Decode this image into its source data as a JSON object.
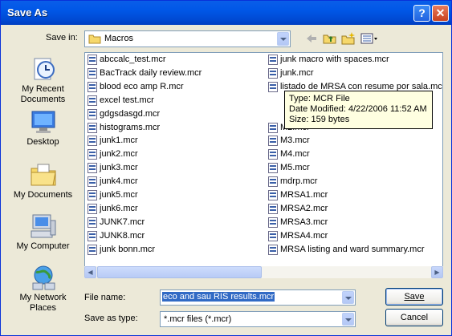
{
  "window": {
    "title": "Save As"
  },
  "header": {
    "save_in_label": "Save in:",
    "save_in_value": "Macros"
  },
  "sidebar": [
    {
      "label": "My Recent Documents"
    },
    {
      "label": "Desktop"
    },
    {
      "label": "My Documents"
    },
    {
      "label": "My Computer"
    },
    {
      "label": "My Network Places"
    }
  ],
  "files_col1": [
    "abccalc_test.mcr",
    "BacTrack daily review.mcr",
    "blood eco amp R.mcr",
    "excel test.mcr",
    "gdgsdasgd.mcr",
    "histograms.mcr",
    "junk1.mcr",
    "junk2.mcr",
    "junk3.mcr",
    "junk4.mcr",
    "junk5.mcr",
    "junk6.mcr",
    "JUNK7.mcr",
    "JUNK8.mcr",
    "junk bonn.mcr"
  ],
  "files_col2": [
    "junk macro with spaces.mcr",
    "junk.mcr",
    "listado de MRSA con resume por sala.mcr",
    "",
    "",
    "M2.mcr",
    "M3.mcr",
    "M4.mcr",
    "M5.mcr",
    "mdrp.mcr",
    "MRSA1.mcr",
    "MRSA2.mcr",
    "MRSA3.mcr",
    "MRSA4.mcr",
    "MRSA listing and ward summary.mcr"
  ],
  "tooltip": {
    "line1": "Type: MCR File",
    "line2": "Date Modified: 4/22/2006 11:52 AM",
    "line3": "Size: 159 bytes"
  },
  "footer": {
    "filename_label": "File name:",
    "filename_value": "eco and sau RIS results.mcr",
    "type_label": "Save as type:",
    "type_value": "*.mcr files (*.mcr)",
    "save_label": "Save",
    "cancel_label": "Cancel"
  }
}
